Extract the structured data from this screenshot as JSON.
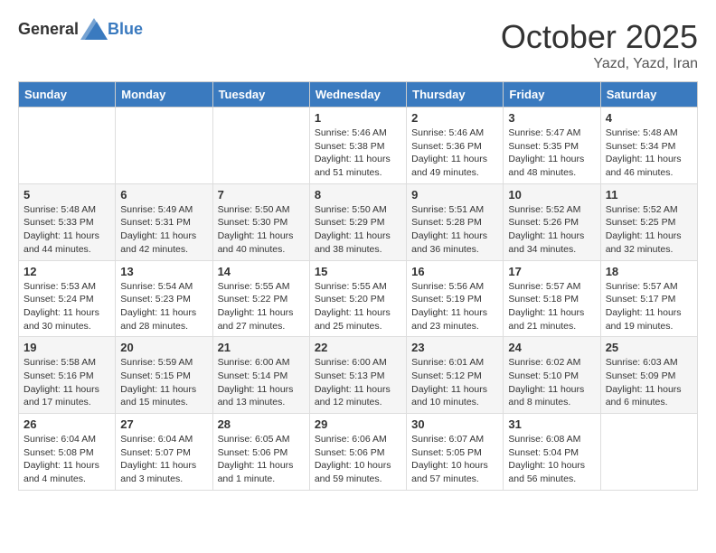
{
  "header": {
    "logo_general": "General",
    "logo_blue": "Blue",
    "month_title": "October 2025",
    "location": "Yazd, Yazd, Iran"
  },
  "days_of_week": [
    "Sunday",
    "Monday",
    "Tuesday",
    "Wednesday",
    "Thursday",
    "Friday",
    "Saturday"
  ],
  "weeks": [
    [
      {
        "day": "",
        "info": ""
      },
      {
        "day": "",
        "info": ""
      },
      {
        "day": "",
        "info": ""
      },
      {
        "day": "1",
        "info": "Sunrise: 5:46 AM\nSunset: 5:38 PM\nDaylight: 11 hours\nand 51 minutes."
      },
      {
        "day": "2",
        "info": "Sunrise: 5:46 AM\nSunset: 5:36 PM\nDaylight: 11 hours\nand 49 minutes."
      },
      {
        "day": "3",
        "info": "Sunrise: 5:47 AM\nSunset: 5:35 PM\nDaylight: 11 hours\nand 48 minutes."
      },
      {
        "day": "4",
        "info": "Sunrise: 5:48 AM\nSunset: 5:34 PM\nDaylight: 11 hours\nand 46 minutes."
      }
    ],
    [
      {
        "day": "5",
        "info": "Sunrise: 5:48 AM\nSunset: 5:33 PM\nDaylight: 11 hours\nand 44 minutes."
      },
      {
        "day": "6",
        "info": "Sunrise: 5:49 AM\nSunset: 5:31 PM\nDaylight: 11 hours\nand 42 minutes."
      },
      {
        "day": "7",
        "info": "Sunrise: 5:50 AM\nSunset: 5:30 PM\nDaylight: 11 hours\nand 40 minutes."
      },
      {
        "day": "8",
        "info": "Sunrise: 5:50 AM\nSunset: 5:29 PM\nDaylight: 11 hours\nand 38 minutes."
      },
      {
        "day": "9",
        "info": "Sunrise: 5:51 AM\nSunset: 5:28 PM\nDaylight: 11 hours\nand 36 minutes."
      },
      {
        "day": "10",
        "info": "Sunrise: 5:52 AM\nSunset: 5:26 PM\nDaylight: 11 hours\nand 34 minutes."
      },
      {
        "day": "11",
        "info": "Sunrise: 5:52 AM\nSunset: 5:25 PM\nDaylight: 11 hours\nand 32 minutes."
      }
    ],
    [
      {
        "day": "12",
        "info": "Sunrise: 5:53 AM\nSunset: 5:24 PM\nDaylight: 11 hours\nand 30 minutes."
      },
      {
        "day": "13",
        "info": "Sunrise: 5:54 AM\nSunset: 5:23 PM\nDaylight: 11 hours\nand 28 minutes."
      },
      {
        "day": "14",
        "info": "Sunrise: 5:55 AM\nSunset: 5:22 PM\nDaylight: 11 hours\nand 27 minutes."
      },
      {
        "day": "15",
        "info": "Sunrise: 5:55 AM\nSunset: 5:20 PM\nDaylight: 11 hours\nand 25 minutes."
      },
      {
        "day": "16",
        "info": "Sunrise: 5:56 AM\nSunset: 5:19 PM\nDaylight: 11 hours\nand 23 minutes."
      },
      {
        "day": "17",
        "info": "Sunrise: 5:57 AM\nSunset: 5:18 PM\nDaylight: 11 hours\nand 21 minutes."
      },
      {
        "day": "18",
        "info": "Sunrise: 5:57 AM\nSunset: 5:17 PM\nDaylight: 11 hours\nand 19 minutes."
      }
    ],
    [
      {
        "day": "19",
        "info": "Sunrise: 5:58 AM\nSunset: 5:16 PM\nDaylight: 11 hours\nand 17 minutes."
      },
      {
        "day": "20",
        "info": "Sunrise: 5:59 AM\nSunset: 5:15 PM\nDaylight: 11 hours\nand 15 minutes."
      },
      {
        "day": "21",
        "info": "Sunrise: 6:00 AM\nSunset: 5:14 PM\nDaylight: 11 hours\nand 13 minutes."
      },
      {
        "day": "22",
        "info": "Sunrise: 6:00 AM\nSunset: 5:13 PM\nDaylight: 11 hours\nand 12 minutes."
      },
      {
        "day": "23",
        "info": "Sunrise: 6:01 AM\nSunset: 5:12 PM\nDaylight: 11 hours\nand 10 minutes."
      },
      {
        "day": "24",
        "info": "Sunrise: 6:02 AM\nSunset: 5:10 PM\nDaylight: 11 hours\nand 8 minutes."
      },
      {
        "day": "25",
        "info": "Sunrise: 6:03 AM\nSunset: 5:09 PM\nDaylight: 11 hours\nand 6 minutes."
      }
    ],
    [
      {
        "day": "26",
        "info": "Sunrise: 6:04 AM\nSunset: 5:08 PM\nDaylight: 11 hours\nand 4 minutes."
      },
      {
        "day": "27",
        "info": "Sunrise: 6:04 AM\nSunset: 5:07 PM\nDaylight: 11 hours\nand 3 minutes."
      },
      {
        "day": "28",
        "info": "Sunrise: 6:05 AM\nSunset: 5:06 PM\nDaylight: 11 hours\nand 1 minute."
      },
      {
        "day": "29",
        "info": "Sunrise: 6:06 AM\nSunset: 5:06 PM\nDaylight: 10 hours\nand 59 minutes."
      },
      {
        "day": "30",
        "info": "Sunrise: 6:07 AM\nSunset: 5:05 PM\nDaylight: 10 hours\nand 57 minutes."
      },
      {
        "day": "31",
        "info": "Sunrise: 6:08 AM\nSunset: 5:04 PM\nDaylight: 10 hours\nand 56 minutes."
      },
      {
        "day": "",
        "info": ""
      }
    ]
  ]
}
